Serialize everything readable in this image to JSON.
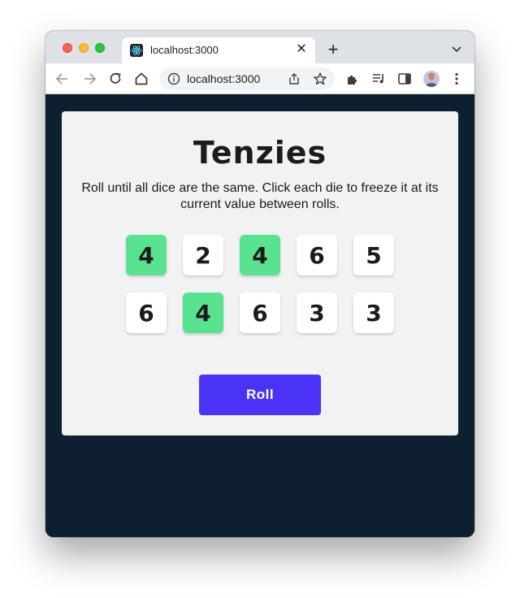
{
  "browser": {
    "tab_title": "localhost:3000",
    "tab_close": "✕",
    "new_tab": "+",
    "url": "localhost:3000"
  },
  "page": {
    "title": "Tenzies",
    "instructions": "Roll until all dice are the same. Click each die to freeze it at its current value between rolls.",
    "roll_label": "Roll"
  },
  "dice": [
    {
      "value": "4",
      "held": true
    },
    {
      "value": "2",
      "held": false
    },
    {
      "value": "4",
      "held": true
    },
    {
      "value": "6",
      "held": false
    },
    {
      "value": "5",
      "held": false
    },
    {
      "value": "6",
      "held": false
    },
    {
      "value": "4",
      "held": true
    },
    {
      "value": "6",
      "held": false
    },
    {
      "value": "3",
      "held": false
    },
    {
      "value": "3",
      "held": false
    }
  ],
  "colors": {
    "background": "#0e202f",
    "card": "#f2f2f2",
    "die": "#ffffff",
    "die_held": "#59e391",
    "button": "#4b33f5"
  },
  "icons": [
    "react-favicon-icon",
    "close-icon",
    "plus-icon",
    "chevron-down-icon",
    "back-arrow-icon",
    "forward-arrow-icon",
    "reload-icon",
    "home-icon",
    "info-icon",
    "share-icon",
    "star-icon",
    "extensions-icon",
    "media-icon",
    "side-panel-icon",
    "avatar",
    "kebab-menu-icon"
  ]
}
